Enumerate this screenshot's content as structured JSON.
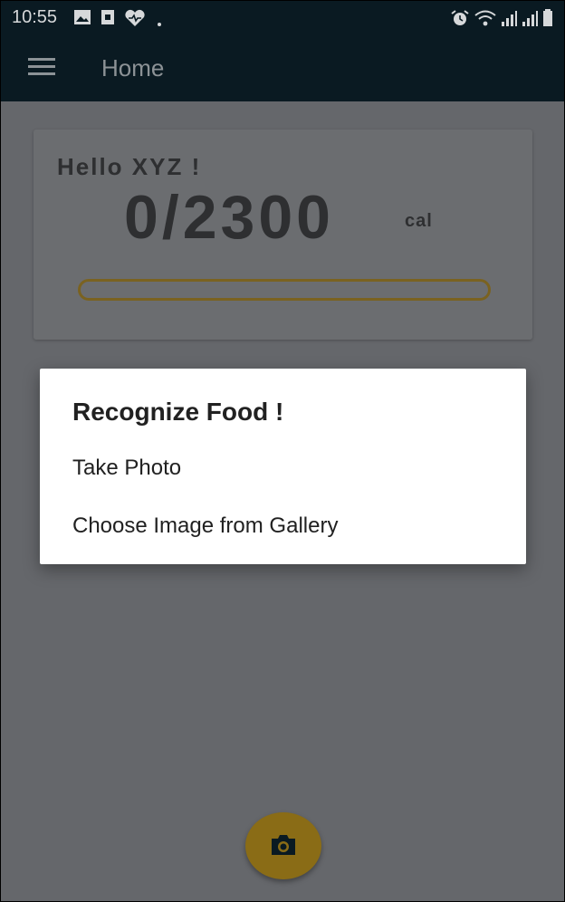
{
  "status_bar": {
    "time": "10:55",
    "left_icons": [
      "image-icon",
      "sim-icon",
      "heart-icon",
      "dot-icon"
    ],
    "right_icons": [
      "alarm-icon",
      "wifi-icon",
      "signal-icon",
      "signal-icon",
      "battery-icon"
    ]
  },
  "app_bar": {
    "menu_icon": "hamburger-menu-icon",
    "title": "Home"
  },
  "card": {
    "greeting": "Hello XYZ !",
    "calories": "0/2300",
    "unit": "cal",
    "progress_fraction": 0
  },
  "dialog": {
    "title": "Recognize Food !",
    "options": [
      "Take Photo",
      "Choose Image from Gallery"
    ]
  },
  "fab": {
    "icon": "camera-icon"
  },
  "colors": {
    "app_bar": "#0a1a22",
    "scrim": "#65676b",
    "accent": "#c9a227"
  }
}
